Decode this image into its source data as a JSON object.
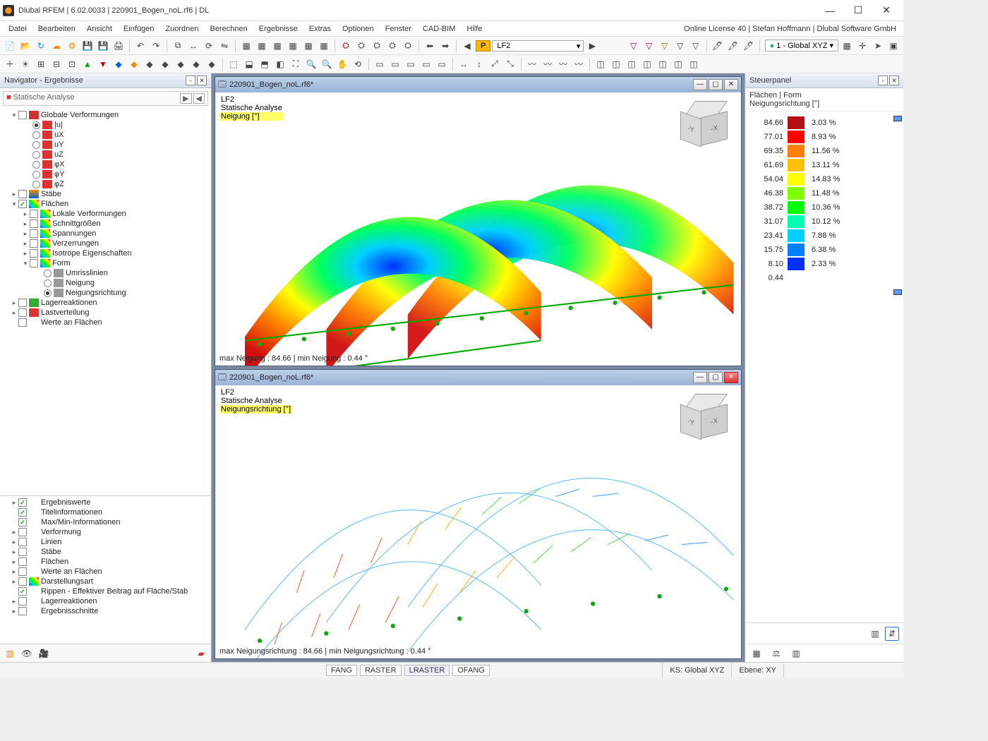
{
  "titlebar": {
    "text": "Dlubal RFEM | 6.02.0033 | 220901_Bogen_noL.rf6 | DL"
  },
  "menu": [
    "Datei",
    "Bearbeiten",
    "Ansicht",
    "Einfügen",
    "Zuordnen",
    "Berechnen",
    "Ergebnisse",
    "Extras",
    "Optionen",
    "Fenster",
    "CAD-BIM",
    "Hilfe"
  ],
  "menu_right": "Online License 40  |  Stefan Hoffmann  |  Dlubal Software GmbH",
  "lf": {
    "badge": "P",
    "name": "LF2"
  },
  "coord": "1 - Global XYZ",
  "navigator": {
    "title": "Navigator - Ergebnisse",
    "dropdown": "Statische Analyse",
    "tree": {
      "globale": "Globale Verformungen",
      "u": "|u|",
      "ux": "uX",
      "uy": "uY",
      "uz": "uZ",
      "phix": "φX",
      "phiy": "φY",
      "phiz": "φZ",
      "staebe": "Stäbe",
      "flaechen": "Flächen",
      "lokale": "Lokale Verformungen",
      "schnitt": "Schnittgrößen",
      "spannungen": "Spannungen",
      "verzerrungen": "Verzerrungen",
      "isotrope": "Isotrope Eigenschaften",
      "form": "Form",
      "umriss": "Umrisslinien",
      "neigung": "Neigung",
      "neigungsrichtung": "Neigungsrichtung",
      "lager": "Lagerreaktionen",
      "lastvert": "Lastverteilung",
      "werte": "Werte an Flächen"
    },
    "lower": {
      "ergebniswerte": "Ergebniswerte",
      "titel": "Titelinformationen",
      "maxmin": "Max/Min-Informationen",
      "verformung": "Verformung",
      "linien": "Linien",
      "staebe": "Stäbe",
      "flaechen": "Flächen",
      "werte": "Werte an Flächen",
      "darstellung": "Darstellungsart",
      "rippen": "Rippen - Effektiver Beitrag auf Fläche/Stab",
      "lager": "Lagerreaktionen",
      "ergebnisschnitte": "Ergebnisschnitte"
    }
  },
  "view1": {
    "tab": "220901_Bogen_noL.rf6*",
    "line1": "LF2",
    "line2": "Statische Analyse",
    "line3": "Neigung  [°]",
    "status": "max Neigung : 84.66 | min Neigung : 0.44 °"
  },
  "view2": {
    "tab": "220901_Bogen_noL.rf6*",
    "line1": "LF2",
    "line2": "Statische Analyse",
    "line3": "Neigungsrichtung  [°]",
    "status": "max Neigungsrichtung : 84.66 | min Neigungsrichtung : 0.44 °"
  },
  "panel": {
    "title": "Steuerpanel",
    "head1": "Flächen | Form",
    "head2": "Neigungsrichtung [°]"
  },
  "legend": [
    {
      "v": "84.66",
      "c": "#b11116",
      "p": "3.03 %"
    },
    {
      "v": "77.01",
      "c": "#ff0000",
      "p": "8.93 %"
    },
    {
      "v": "69.35",
      "c": "#ff8000",
      "p": "11.56 %"
    },
    {
      "v": "61.69",
      "c": "#ffc000",
      "p": "13.11 %"
    },
    {
      "v": "54.04",
      "c": "#ffff00",
      "p": "14.83 %"
    },
    {
      "v": "46.38",
      "c": "#80ff00",
      "p": "11.48 %"
    },
    {
      "v": "38.72",
      "c": "#00ff00",
      "p": "10.36 %"
    },
    {
      "v": "31.07",
      "c": "#00ffb0",
      "p": "10.12 %"
    },
    {
      "v": "23.41",
      "c": "#00d0ff",
      "p": "7.88 %"
    },
    {
      "v": "15.75",
      "c": "#0080ff",
      "p": "6.38 %"
    },
    {
      "v": "8.10",
      "c": "#0030ff",
      "p": "2.33 %"
    },
    {
      "v": "0.44",
      "c": "#000080",
      "p": ""
    }
  ],
  "status": {
    "btns": [
      "FANG",
      "RASTER",
      "LRASTER",
      "OFANG"
    ],
    "ks": "KS: Global XYZ",
    "ebene": "Ebene: XY"
  },
  "chart_data": {
    "type": "heatmap-legend",
    "title": "Neigungsrichtung [°]",
    "range": [
      0.44,
      84.66
    ],
    "bins": [
      {
        "from": 77.01,
        "to": 84.66,
        "color": "#b11116",
        "pct": 3.03
      },
      {
        "from": 69.35,
        "to": 77.01,
        "color": "#ff0000",
        "pct": 8.93
      },
      {
        "from": 61.69,
        "to": 69.35,
        "color": "#ff8000",
        "pct": 11.56
      },
      {
        "from": 54.04,
        "to": 61.69,
        "color": "#ffc000",
        "pct": 13.11
      },
      {
        "from": 46.38,
        "to": 54.04,
        "color": "#ffff00",
        "pct": 14.83
      },
      {
        "from": 38.72,
        "to": 46.38,
        "color": "#80ff00",
        "pct": 11.48
      },
      {
        "from": 31.07,
        "to": 38.72,
        "color": "#00ff00",
        "pct": 10.36
      },
      {
        "from": 23.41,
        "to": 31.07,
        "color": "#00ffb0",
        "pct": 10.12
      },
      {
        "from": 15.75,
        "to": 23.41,
        "color": "#00d0ff",
        "pct": 7.88
      },
      {
        "from": 8.1,
        "to": 15.75,
        "color": "#0080ff",
        "pct": 6.38
      },
      {
        "from": 0.44,
        "to": 8.1,
        "color": "#000080",
        "pct": 2.33
      }
    ]
  }
}
